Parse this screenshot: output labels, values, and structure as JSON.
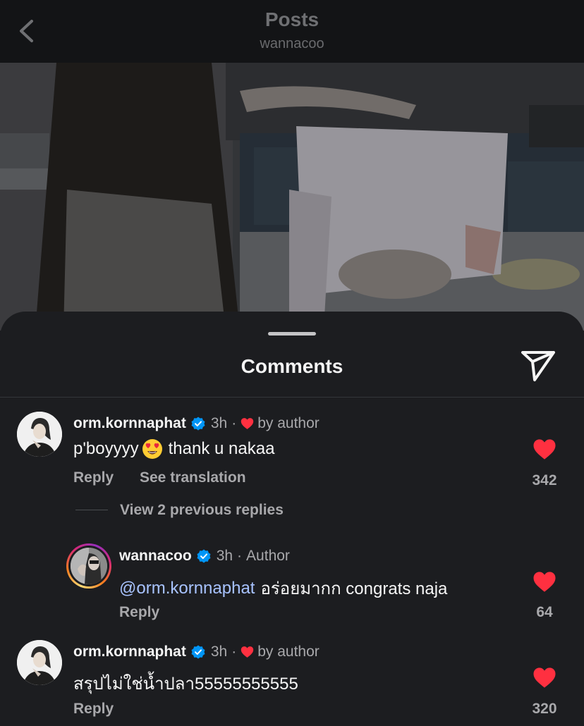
{
  "header": {
    "title": "Posts",
    "subtitle": "wannacoo"
  },
  "sheet": {
    "title": "Comments"
  },
  "comments": [
    {
      "username": "orm.kornnaphat",
      "time": "3h",
      "separator": "·",
      "tag": "by author",
      "text": "p'boyyyy",
      "text_after_emoji": "thank u nakaa",
      "emoji": "heart-eyes-emoji",
      "reply_label": "Reply",
      "translate_label": "See translation",
      "likes": "342"
    },
    {
      "view_replies": "View 2 previous replies"
    },
    {
      "username": "wannacoo",
      "time": "3h",
      "separator": "·",
      "tag": "Author",
      "mention": "@orm.kornnaphat",
      "text": "อร่อยมากก congrats naja",
      "reply_label": "Reply",
      "likes": "64"
    },
    {
      "username": "orm.kornnaphat",
      "time": "3h",
      "separator": "·",
      "tag": "by author",
      "text": "สรุปไม่ใช่น้ำปลา55555555555",
      "reply_label": "Reply",
      "likes": "320"
    }
  ],
  "colors": {
    "like_red": "#ff3040",
    "verified_blue": "#0095f6",
    "mention": "#a8c3ff"
  }
}
